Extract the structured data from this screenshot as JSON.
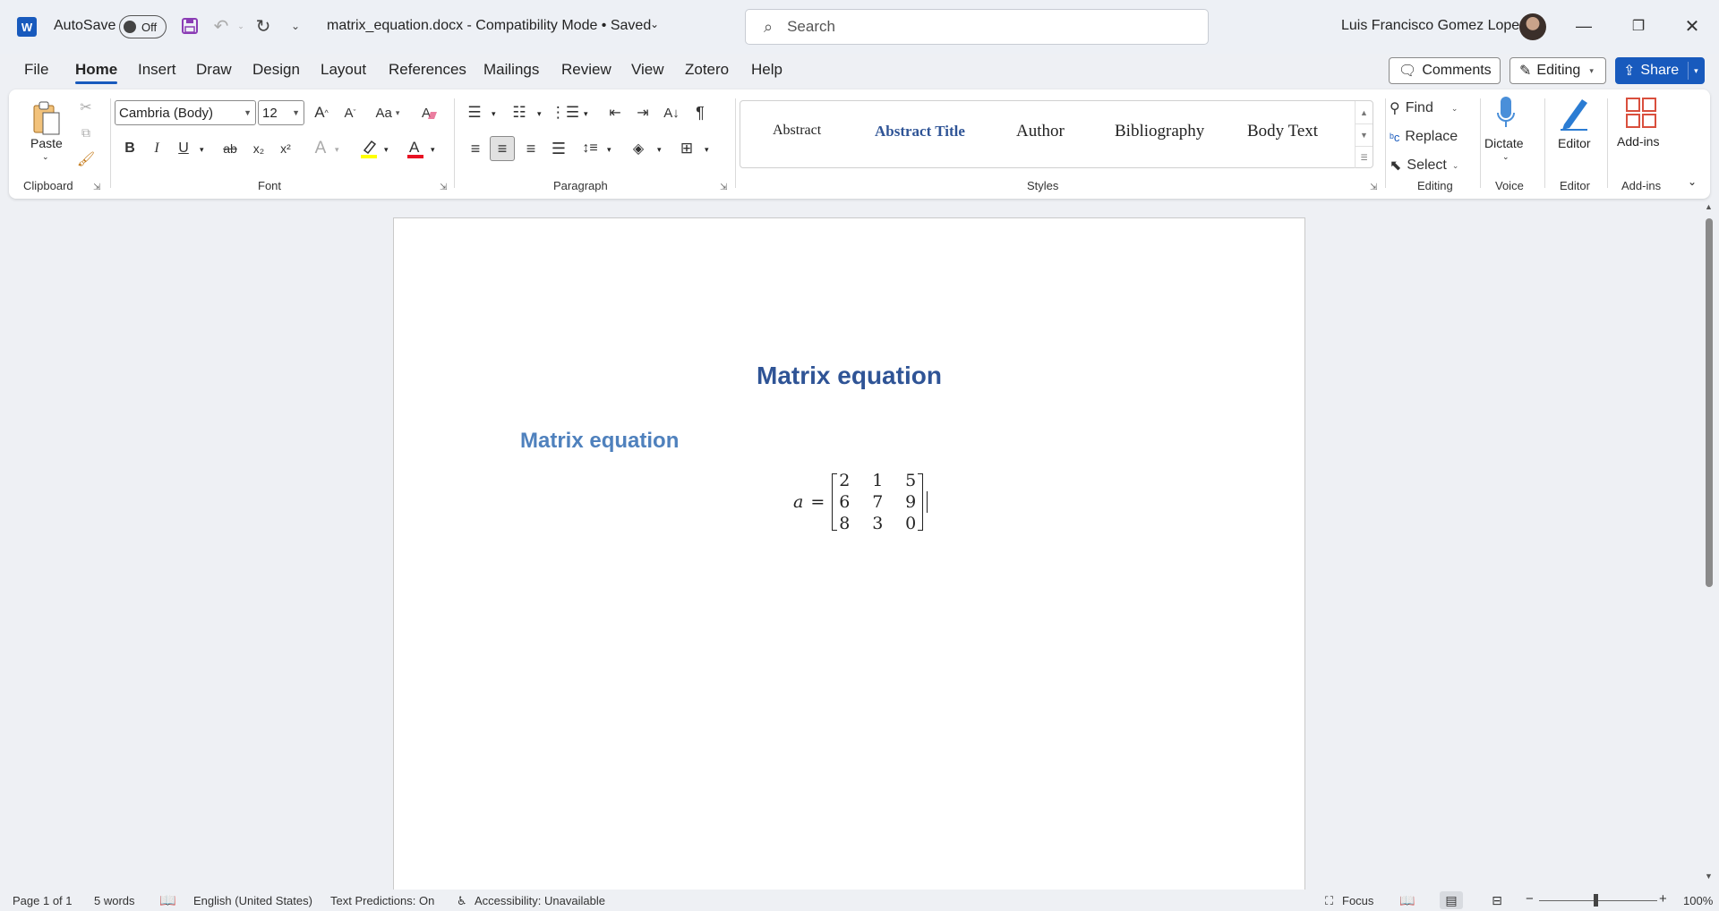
{
  "titlebar": {
    "app_logo": "W",
    "autosave_label": "AutoSave",
    "autosave_state": "Off",
    "document_title": "matrix_equation.docx  -  Compatibility Mode  •  Saved",
    "search_placeholder": "Search",
    "user_name": "Luis Francisco Gomez Lopez"
  },
  "tabs": [
    "File",
    "Home",
    "Insert",
    "Draw",
    "Design",
    "Layout",
    "References",
    "Mailings",
    "Review",
    "View",
    "Zotero",
    "Help"
  ],
  "active_tab": "Home",
  "top_buttons": {
    "comments": "Comments",
    "editing": "Editing",
    "share": "Share"
  },
  "ribbon": {
    "clipboard": {
      "paste": "Paste",
      "label": "Clipboard"
    },
    "font": {
      "font_name": "Cambria (Body)",
      "font_size": "12",
      "change_case": "Aa",
      "bold": "B",
      "italic": "I",
      "underline": "U",
      "strikethrough": "ab",
      "subscript": "x₂",
      "superscript": "x²",
      "label": "Font"
    },
    "paragraph": {
      "label": "Paragraph"
    },
    "styles": {
      "items": [
        "Abstract",
        "Abstract Title",
        "Author",
        "Bibliography",
        "Body Text"
      ],
      "label": "Styles"
    },
    "editing": {
      "find": "Find",
      "replace": "Replace",
      "select": "Select",
      "label": "Editing"
    },
    "voice": {
      "dictate": "Dictate",
      "label": "Voice"
    },
    "editor": {
      "editor": "Editor",
      "label": "Editor"
    },
    "addins": {
      "addins": "Add-ins",
      "label": "Add-ins"
    }
  },
  "document": {
    "heading1": "Matrix equation",
    "heading2": "Matrix equation",
    "equation": {
      "lhs": "a",
      "equals": "=",
      "matrix": [
        [
          "2",
          "1",
          "5"
        ],
        [
          "6",
          "7",
          "9"
        ],
        [
          "8",
          "3",
          "0"
        ]
      ]
    }
  },
  "statusbar": {
    "page": "Page 1 of 1",
    "words": "5 words",
    "language": "English (United States)",
    "text_predictions": "Text Predictions: On",
    "accessibility": "Accessibility: Unavailable",
    "focus": "Focus",
    "zoom": "100%"
  },
  "colors": {
    "accent": "#185abd",
    "heading1": "#2f5496",
    "heading2": "#4f81bd",
    "highlight": "#ffff00",
    "font_color": "#e81123"
  }
}
